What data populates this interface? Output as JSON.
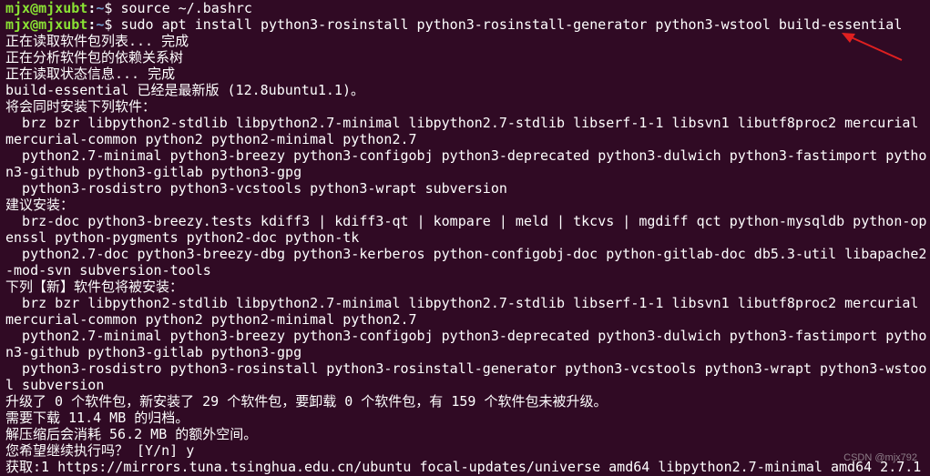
{
  "terminal": {
    "prompt1": {
      "user": "mjx@mjxubt",
      "sep": ":",
      "path": "~",
      "dollar": "$ ",
      "command": "source ~/.bashrc"
    },
    "prompt2": {
      "user": "mjx@mjxubt",
      "sep": ":",
      "path": "~",
      "dollar": "$ ",
      "command": "sudo apt install python3-rosinstall python3-rosinstall-generator python3-wstool build-essential"
    },
    "output": [
      "正在读取软件包列表... 完成",
      "正在分析软件包的依赖关系树",
      "正在读取状态信息... 完成",
      "build-essential 已经是最新版 (12.8ubuntu1.1)。",
      "将会同时安装下列软件：",
      "  brz bzr libpython2-stdlib libpython2.7-minimal libpython2.7-stdlib libserf-1-1 libsvn1 libutf8proc2 mercurial",
      "mercurial-common python2 python2-minimal python2.7",
      "  python2.7-minimal python3-breezy python3-configobj python3-deprecated python3-dulwich python3-fastimport pytho",
      "n3-github python3-gitlab python3-gpg",
      "  python3-rosdistro python3-vcstools python3-wrapt subversion",
      "建议安装：",
      "  brz-doc python3-breezy.tests kdiff3 | kdiff3-qt | kompare | meld | tkcvs | mgdiff qct python-mysqldb python-op",
      "enssl python-pygments python2-doc python-tk",
      "  python2.7-doc python3-breezy-dbg python3-kerberos python-configobj-doc python-gitlab-doc db5.3-util libapache2",
      "-mod-svn subversion-tools",
      "下列【新】软件包将被安装：",
      "  brz bzr libpython2-stdlib libpython2.7-minimal libpython2.7-stdlib libserf-1-1 libsvn1 libutf8proc2 mercurial",
      "mercurial-common python2 python2-minimal python2.7",
      "  python2.7-minimal python3-breezy python3-configobj python3-deprecated python3-dulwich python3-fastimport pytho",
      "n3-github python3-gitlab python3-gpg",
      "  python3-rosdistro python3-rosinstall python3-rosinstall-generator python3-vcstools python3-wrapt python3-wstoo",
      "l subversion",
      "升级了 0 个软件包，新安装了 29 个软件包，要卸载 0 个软件包，有 159 个软件包未被升级。",
      "需要下载 11.4 MB 的归档。",
      "解压缩后会消耗 56.2 MB 的额外空间。",
      "您希望继续执行吗？ [Y/n] y",
      "获取:1 https://mirrors.tuna.tsinghua.edu.cn/ubuntu focal-updates/universe amd64 libpython2.7-minimal amd64 2.7.1"
    ],
    "colors": {
      "background": "#300a24",
      "text": "#ffffff",
      "prompt_user": "#8ae234",
      "prompt_path": "#729fcf",
      "annotation_arrow": "#e02020"
    },
    "annotation": {
      "icon": "red-arrow-icon"
    },
    "watermark": "CSDN @mjx792"
  }
}
